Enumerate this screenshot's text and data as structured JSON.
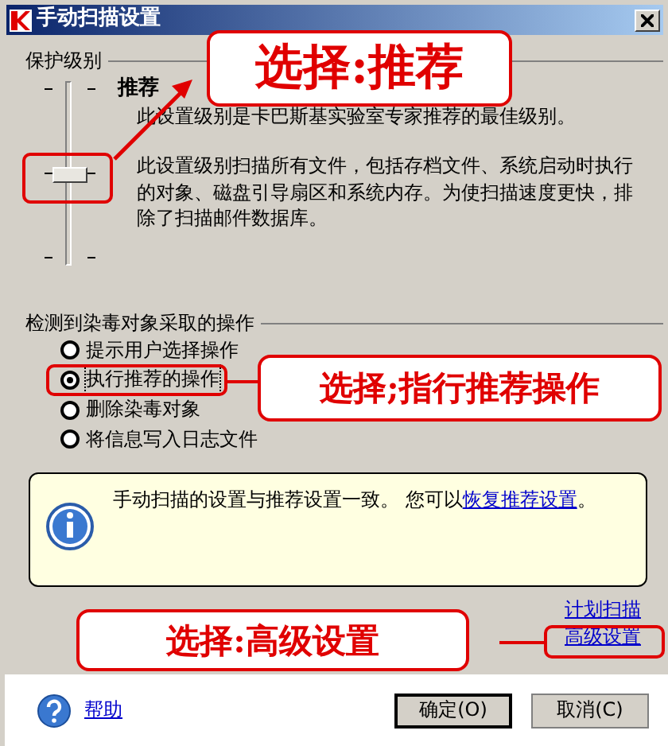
{
  "window": {
    "title": "手动扫描设置"
  },
  "protection_level": {
    "label": "保护级别",
    "slider": {
      "level": 0.5
    },
    "level_name": "推荐",
    "summary": "此设置级别是卡巴斯基实验室专家推荐的最佳级别。",
    "description": "此设置级别扫描所有文件，包括存档文件、系统启动时执行的对象、磁盘引导扇区和系统内存。为使扫描速度更快，排除了扫描邮件数据库。"
  },
  "actions": {
    "label": "检测到染毒对象采取的操作",
    "options": [
      {
        "label": "提示用户选择操作",
        "selected": false
      },
      {
        "label": "执行推荐的操作",
        "selected": true
      },
      {
        "label": "删除染毒对象",
        "selected": false
      },
      {
        "label": "将信息写入日志文件",
        "selected": false
      }
    ]
  },
  "info": {
    "text": "手动扫描的设置与推荐设置一致。 您可以",
    "link": "恢复推荐设置",
    "text_end": "。"
  },
  "links": [
    "计划扫描",
    "高级设置"
  ],
  "help": "帮助",
  "buttons": [
    {
      "label": "确定(O)",
      "default": true
    },
    {
      "label": "取消(C)",
      "default": false
    }
  ],
  "annotations": [
    {
      "text": "选择:推荐"
    },
    {
      "text": "选择;指行推荐操作"
    },
    {
      "text": "选择:高级设置"
    }
  ]
}
